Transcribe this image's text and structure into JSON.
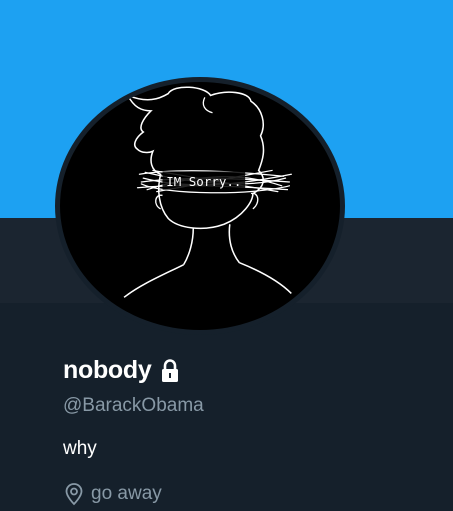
{
  "profile": {
    "display_name": "nobody",
    "handle": "@BarackObama",
    "bio": "why",
    "location": "go away",
    "protected": true
  },
  "avatar": {
    "drawing_text": "IM Sorry..",
    "description_icon": "sketch-avatar"
  },
  "colors": {
    "banner": "#1da1f2",
    "header_band": "#1b2530",
    "background": "#15202b",
    "text_primary": "#ffffff",
    "text_secondary": "#8899a6"
  },
  "icons": {
    "lock": "lock-icon",
    "location": "location-pin-icon"
  }
}
